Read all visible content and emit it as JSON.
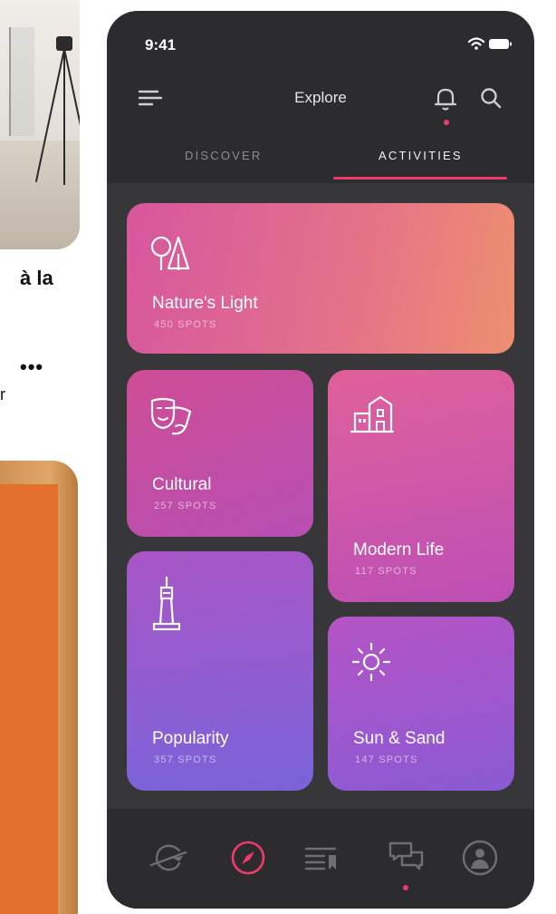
{
  "background": {
    "caption_line_1": "à la",
    "more_label": "•••",
    "stray_char": "r"
  },
  "status_bar": {
    "time": "9:41"
  },
  "header": {
    "title": "Explore"
  },
  "tabs": [
    {
      "label": "DISCOVER",
      "active": false
    },
    {
      "label": "ACTIVITIES",
      "active": true
    }
  ],
  "cards": [
    {
      "title": "Nature's Light",
      "spots": "450 SPOTS",
      "icon": "trees-icon"
    },
    {
      "title": "Cultural",
      "spots": "257 SPOTS",
      "icon": "theater-masks-icon"
    },
    {
      "title": "Modern Life",
      "spots": "117 SPOTS",
      "icon": "buildings-icon"
    },
    {
      "title": "Popularity",
      "spots": "357 SPOTS",
      "icon": "tower-icon"
    },
    {
      "title": "Sun & Sand",
      "spots": "147 SPOTS",
      "icon": "sun-icon"
    }
  ],
  "bottom_nav": [
    {
      "icon": "planet-plane-icon",
      "active": false
    },
    {
      "icon": "compass-icon",
      "active": true
    },
    {
      "icon": "list-bookmark-icon",
      "active": false
    },
    {
      "icon": "chat-icon",
      "active": false,
      "notification": true
    },
    {
      "icon": "profile-icon",
      "active": false
    }
  ],
  "colors": {
    "accent": "#ef3a6e",
    "phone_background": "#2c2c2e",
    "content_background": "#373739"
  }
}
